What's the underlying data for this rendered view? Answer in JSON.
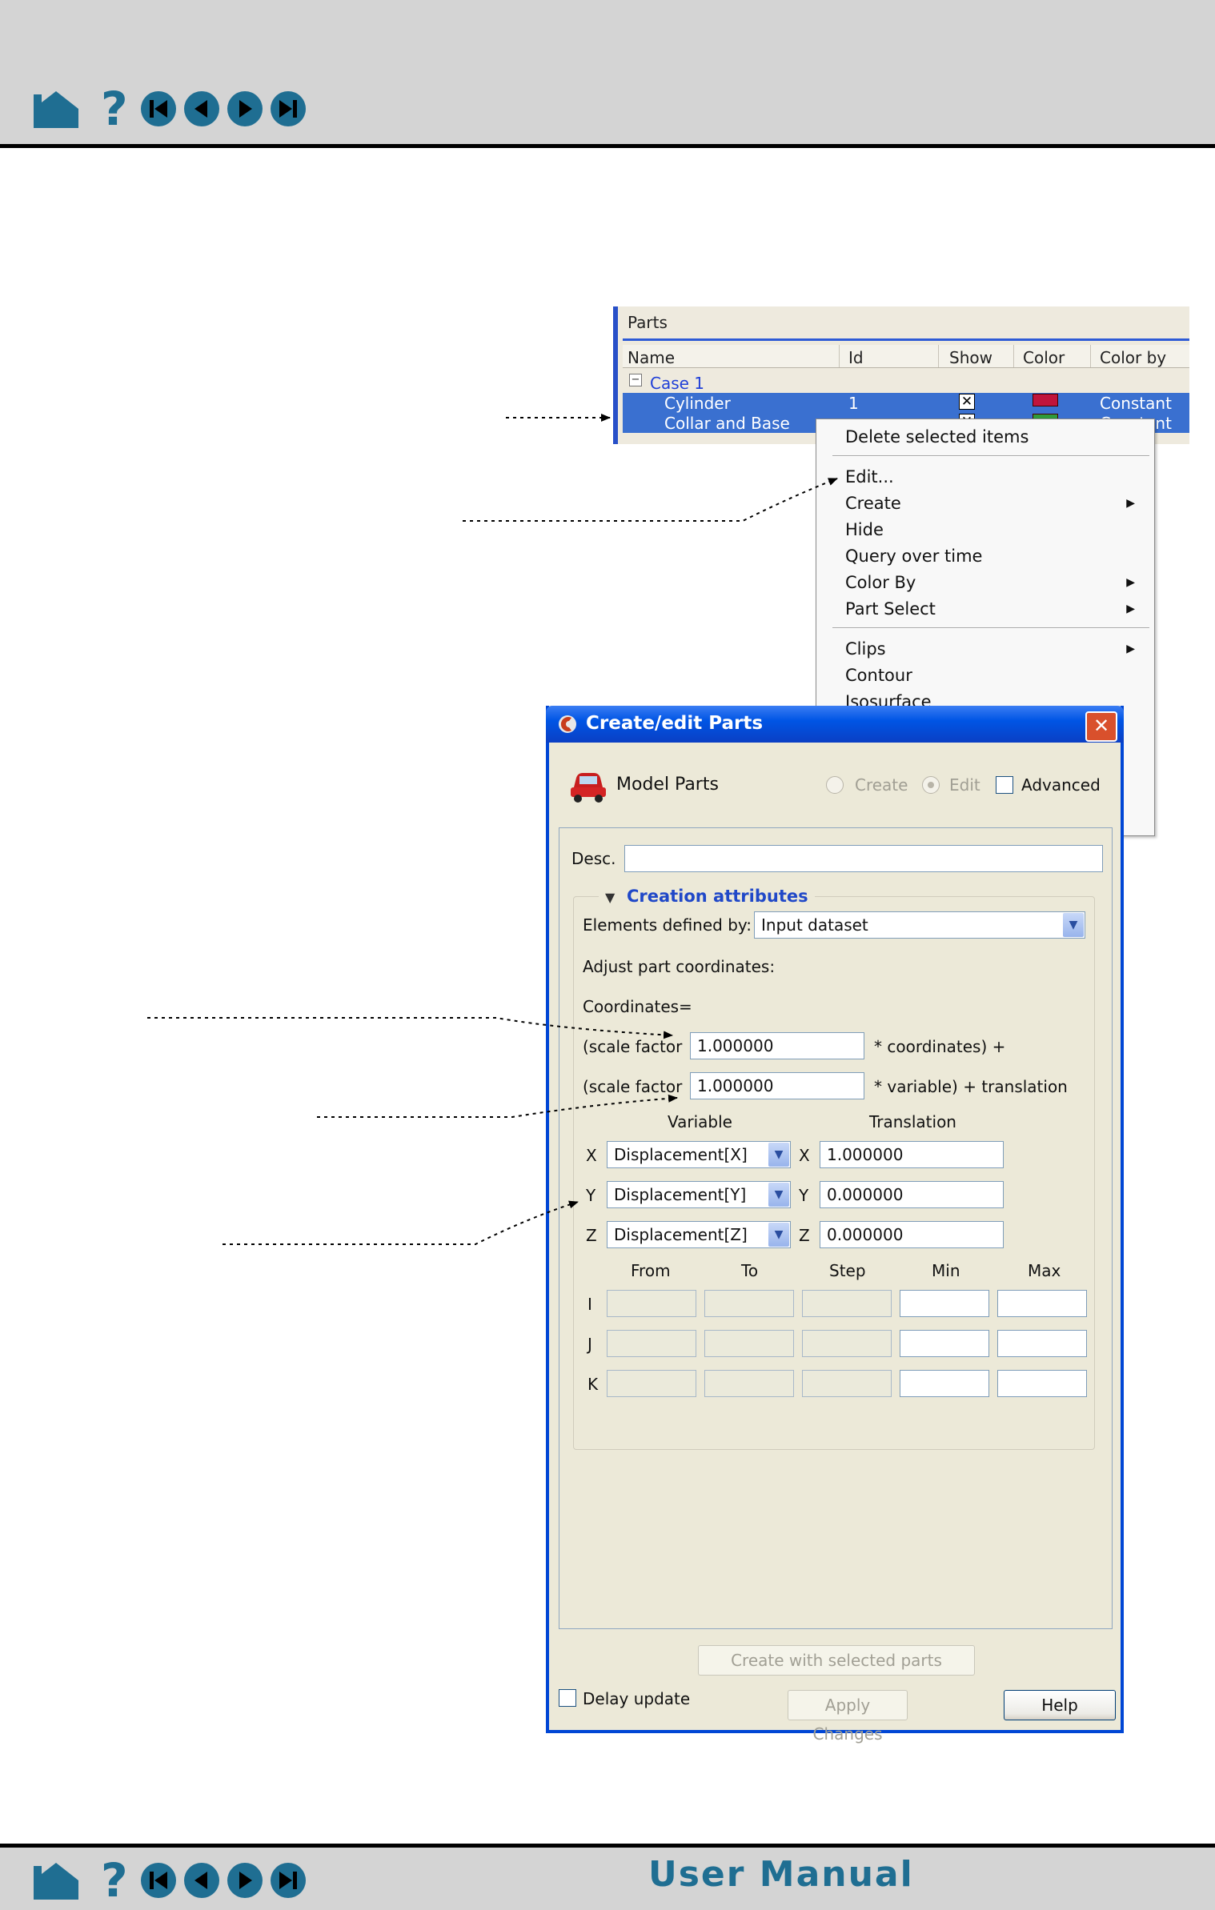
{
  "footer": {
    "title": "User Manual"
  },
  "parts_panel": {
    "title": "Parts",
    "columns": [
      "Name",
      "Id",
      "Show",
      "Color",
      "Color by"
    ],
    "rows": [
      {
        "name": "Case 1"
      },
      {
        "name": "Cylinder",
        "id": "1",
        "color_by": "Constant"
      },
      {
        "name": "Collar and Base",
        "color_by": "Constant"
      }
    ],
    "swatch_color": "#c0143c"
  },
  "context_menu": {
    "items": [
      "Delete selected items",
      "Edit...",
      "Create",
      "Hide",
      "Query over time",
      "Color By",
      "Part Select",
      "Clips",
      "Contour",
      "Isosurface"
    ]
  },
  "dialog": {
    "title": "Create/edit Parts",
    "model_parts_label": "Model Parts",
    "create_radio": "Create",
    "edit_radio": "Edit",
    "advanced_label": "Advanced",
    "desc_label": "Desc.",
    "desc_value": "",
    "group_title": "Creation attributes",
    "elements_label": "Elements defined by:",
    "elements_value": "Input dataset",
    "adjust_label": "Adjust part coordinates:",
    "coordinates_label": "Coordinates=",
    "scale_label_1": "(scale factor",
    "scale_value_1": "1.000000",
    "scale_suffix_1": "* coordinates) +",
    "scale_label_2": "(scale factor",
    "scale_value_2": "1.000000",
    "scale_suffix_2": "* variable) + translation",
    "variable_header": "Variable",
    "translation_header": "Translation",
    "axes": [
      {
        "axis": "X",
        "variable": "Displacement[X]",
        "translation": "1.000000"
      },
      {
        "axis": "Y",
        "variable": "Displacement[Y]",
        "translation": "0.000000"
      },
      {
        "axis": "Z",
        "variable": "Displacement[Z]",
        "translation": "0.000000"
      }
    ],
    "ijk_headers": [
      "From",
      "To",
      "Step",
      "Min",
      "Max"
    ],
    "ijk_rows": [
      "I",
      "J",
      "K"
    ],
    "create_button": "Create with selected parts",
    "delay_label": "Delay update",
    "apply_button": "Apply Changes",
    "help_button": "Help"
  },
  "colors": {
    "accent": "#1f6e92",
    "title_bar": "#0055e5",
    "selection": "#3a70d0",
    "link": "#2040d8"
  }
}
